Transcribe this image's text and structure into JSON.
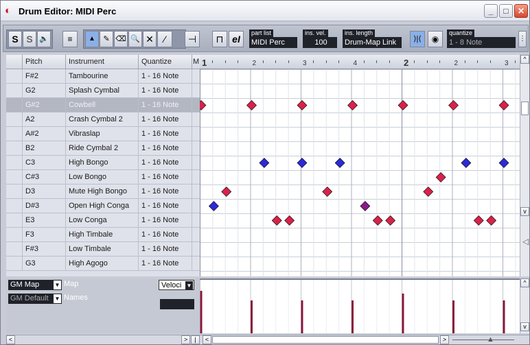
{
  "window": {
    "title": "Drum Editor: MIDI Perc",
    "minimize": "_",
    "maximize": "□",
    "close": "✕"
  },
  "toolbar": {
    "solo": "S",
    "listen": "S",
    "speaker": "🔈",
    "show_info": "≡",
    "arrow": "▲",
    "draw": "✎",
    "eraser": "⌫",
    "zoom": "🔍",
    "mute": "✕",
    "line": "⁄",
    "insert": "⊣",
    "loop": "⊓",
    "edit_inplace": "eI",
    "part_list_label": "part list",
    "part_list_value": "MIDI Perc",
    "ins_vel_label": "ins. vel.",
    "ins_vel_value": "100",
    "ins_length_label": "ins. length",
    "ins_length_value": "Drum-Map Link",
    "quantize_label": "quantize",
    "quantize_value": "1 - 8 Note"
  },
  "columns": {
    "pitch": "Pitch",
    "instrument": "Instrument",
    "quantize": "Quantize",
    "m": "M"
  },
  "rows": [
    {
      "pitch": "F#2",
      "instrument": "Tambourine",
      "quantize": "1 - 16 Note"
    },
    {
      "pitch": "G2",
      "instrument": "Splash Cymbal",
      "quantize": "1 - 16 Note"
    },
    {
      "pitch": "G#2",
      "instrument": "Cowbell",
      "quantize": "1 - 16 Note"
    },
    {
      "pitch": "A2",
      "instrument": "Crash Cymbal 2",
      "quantize": "1 - 16 Note"
    },
    {
      "pitch": "A#2",
      "instrument": "Vibraslap",
      "quantize": "1 - 16 Note"
    },
    {
      "pitch": "B2",
      "instrument": "Ride Cymbal 2",
      "quantize": "1 - 16 Note"
    },
    {
      "pitch": "C3",
      "instrument": "High Bongo",
      "quantize": "1 - 16 Note"
    },
    {
      "pitch": "C#3",
      "instrument": "Low Bongo",
      "quantize": "1 - 16 Note"
    },
    {
      "pitch": "D3",
      "instrument": "Mute High Bongo",
      "quantize": "1 - 16 Note"
    },
    {
      "pitch": "D#3",
      "instrument": "Open High Conga",
      "quantize": "1 - 16 Note"
    },
    {
      "pitch": "E3",
      "instrument": "Low Conga",
      "quantize": "1 - 16 Note"
    },
    {
      "pitch": "F3",
      "instrument": "High Timbale",
      "quantize": "1 - 16 Note"
    },
    {
      "pitch": "F#3",
      "instrument": "Low Timbale",
      "quantize": "1 - 16 Note"
    },
    {
      "pitch": "G3",
      "instrument": "High Agogo",
      "quantize": "1 - 16 Note"
    }
  ],
  "selected_row": 2,
  "ruler": {
    "labels": [
      "1",
      "2",
      "3",
      "4",
      "2",
      "2",
      "3"
    ]
  },
  "notes": [
    {
      "row": 2,
      "beats": [
        0,
        1,
        2,
        3,
        4,
        5,
        6
      ],
      "color": "#d8224a"
    },
    {
      "row": 6,
      "beats": [
        1.25,
        2,
        2.75,
        5.25,
        6
      ],
      "color": "#2c2ad8"
    },
    {
      "row": 7,
      "beats": [
        4.75
      ],
      "color": "#d8224a"
    },
    {
      "row": 8,
      "beats": [
        0.5,
        2.5,
        4.5
      ],
      "color": "#d8224a"
    },
    {
      "row": 9,
      "beats": [
        0.25
      ],
      "color": "#2c2ad8"
    },
    {
      "row": 9,
      "beats": [
        3.25
      ],
      "color": "#8a1a8a"
    },
    {
      "row": 10,
      "beats": [
        1.5,
        1.75,
        3.5,
        3.75,
        5.5,
        5.75
      ],
      "color": "#d8224a"
    }
  ],
  "velocity_bars": [
    0,
    1,
    2,
    3,
    4,
    5,
    6
  ],
  "lower": {
    "map_select": "GM Map",
    "map_label": "Map",
    "names_select": "GM Default",
    "names_label": "Names",
    "velocity_select": "Veloci"
  },
  "colors": {
    "note_red": "#d8224a",
    "note_blue": "#2c2ad8",
    "velocity_bar": "#8a1a3a"
  }
}
